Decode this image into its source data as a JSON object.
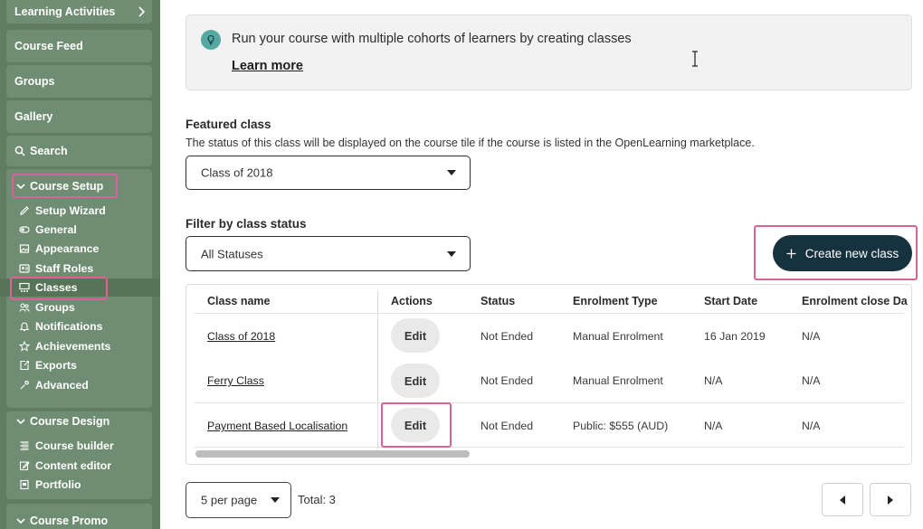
{
  "sidebar": {
    "blocks": [
      {
        "label": "Learning Activities"
      },
      {
        "label": "Course Feed"
      },
      {
        "label": "Groups"
      },
      {
        "label": "Gallery"
      },
      {
        "label": "Search"
      }
    ],
    "course_setup": {
      "heading": "Course Setup",
      "items": [
        {
          "label": "Setup Wizard",
          "icon": "pencil-icon"
        },
        {
          "label": "General",
          "icon": "toggle-icon"
        },
        {
          "label": "Appearance",
          "icon": "image-icon"
        },
        {
          "label": "Staff Roles",
          "icon": "user-card-icon"
        },
        {
          "label": "Classes",
          "icon": "classes-icon"
        },
        {
          "label": "Groups",
          "icon": "users-icon"
        },
        {
          "label": "Notifications",
          "icon": "bell-icon"
        },
        {
          "label": "Achievements",
          "icon": "star-icon"
        },
        {
          "label": "Exports",
          "icon": "export-icon"
        },
        {
          "label": "Advanced",
          "icon": "wrench-icon"
        }
      ]
    },
    "course_design": {
      "heading": "Course Design",
      "items": [
        {
          "label": "Course builder",
          "icon": "builder-icon"
        },
        {
          "label": "Content editor",
          "icon": "edit-icon"
        },
        {
          "label": "Portfolio",
          "icon": "portfolio-icon"
        }
      ]
    },
    "course_promo": {
      "heading": "Course Promo"
    }
  },
  "banner": {
    "text": "Run your course with multiple cohorts of learners by creating classes",
    "link": "Learn more"
  },
  "featured": {
    "title": "Featured class",
    "description": "The status of this class will be displayed on the course tile if the course is listed in the OpenLearning marketplace.",
    "selected": "Class of 2018"
  },
  "filter": {
    "title": "Filter by class status",
    "selected": "All Statuses"
  },
  "create_button": {
    "label": "Create new class"
  },
  "table": {
    "headers": [
      "Class name",
      "Actions",
      "Status",
      "Enrolment Type",
      "Start Date",
      "Enrolment close Da"
    ],
    "rows": [
      {
        "name": "Class of 2018",
        "action": "Edit",
        "status": "Not Ended",
        "enrolment_type": "Manual Enrolment",
        "start_date": "16 Jan 2019",
        "close_date": "N/A"
      },
      {
        "name": "Ferry Class",
        "action": "Edit",
        "status": "Not Ended",
        "enrolment_type": "Manual Enrolment",
        "start_date": "N/A",
        "close_date": "N/A"
      },
      {
        "name": "Payment Based Localisation",
        "action": "Edit",
        "status": "Not Ended",
        "enrolment_type": "Public: $555 (AUD)",
        "start_date": "N/A",
        "close_date": "N/A"
      }
    ]
  },
  "pagination": {
    "per_page": "5 per page",
    "total": "Total: 3"
  },
  "colors": {
    "sidebar_bg": "#5f7d62",
    "sidebar_block": "#6f8d72",
    "accent_dark": "#17323f",
    "highlight": "#d9629a",
    "bulb": "#55a9a0"
  }
}
